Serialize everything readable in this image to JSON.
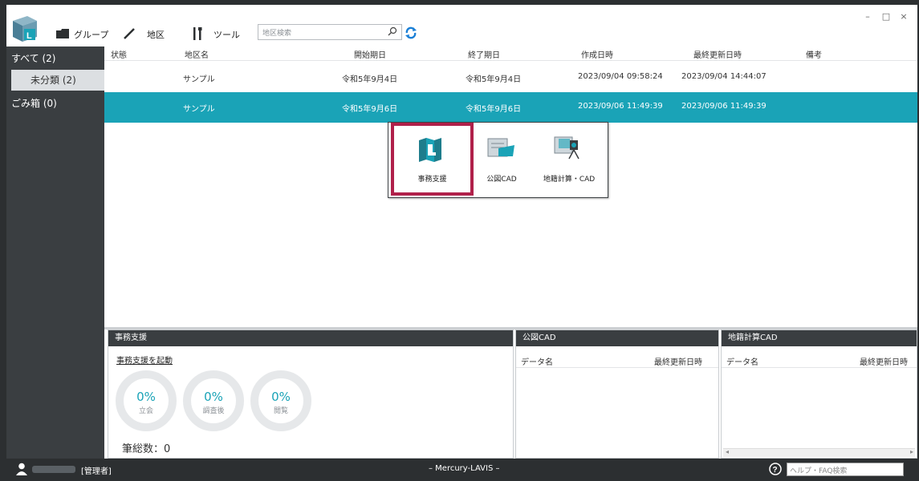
{
  "toolbar": {
    "group_label": "グループ",
    "area_label": "地区",
    "tool_label": "ツール",
    "search_placeholder": "地区検索"
  },
  "window": {
    "minimize": "–",
    "maximize": "□",
    "close": "×"
  },
  "sidebar": {
    "items": [
      {
        "label": "すべて (2)"
      },
      {
        "label": "未分類 (2)",
        "selected": true
      },
      {
        "label": "ごみ箱 (0)"
      }
    ]
  },
  "table": {
    "headers": [
      "状態",
      "地区名",
      "開始期日",
      "終了期日",
      "作成日時",
      "最終更新日時",
      "備考"
    ],
    "rows": [
      {
        "status": "",
        "name": "サンプル",
        "start": "令和5年9月4日",
        "end": "令和5年9月4日",
        "created": "2023/09/04 09:58:24",
        "updated": "2023/09/04 14:44:07",
        "note": ""
      },
      {
        "status": "",
        "name": "サンプル",
        "start": "令和5年9月6日",
        "end": "令和5年9月6日",
        "created": "2023/09/06 11:49:39",
        "updated": "2023/09/06 11:49:39",
        "note": "",
        "selected": true
      }
    ]
  },
  "popup": {
    "items": [
      {
        "label": "事務支援",
        "icon": "office-support-icon"
      },
      {
        "label": "公図CAD",
        "icon": "map-cad-icon"
      },
      {
        "label": "地籍計算・CAD",
        "icon": "survey-cad-icon"
      }
    ]
  },
  "panels": {
    "office": {
      "title": "事務支援",
      "launch_link": "事務支援を起動",
      "stats": [
        {
          "percent": "0%",
          "label": "立会"
        },
        {
          "percent": "0%",
          "label": "調査後"
        },
        {
          "percent": "0%",
          "label": "閲覧"
        }
      ],
      "total_label": "筆総数：0"
    },
    "map_cad": {
      "title": "公図CAD",
      "col_name": "データ名",
      "col_updated": "最終更新日時"
    },
    "survey_cad": {
      "title": "地籍計算CAD",
      "col_name": "データ名",
      "col_updated": "最終更新日時"
    }
  },
  "statusbar": {
    "role": "[管理者]",
    "app_name": "– Mercury-LAVIS –",
    "help_placeholder": "ヘルプ・FAQ検索"
  },
  "colors": {
    "accent": "#1aa3b7",
    "dark": "#3a3e41",
    "highlight": "#b0204a"
  }
}
